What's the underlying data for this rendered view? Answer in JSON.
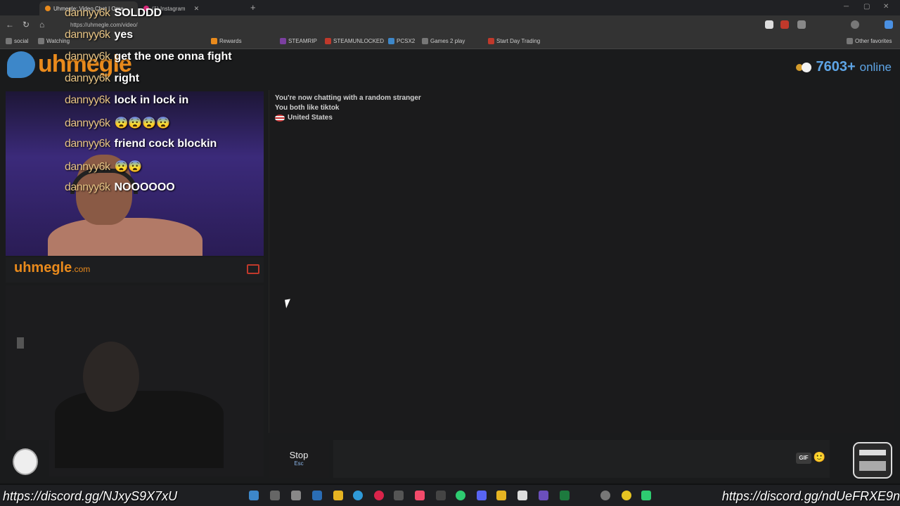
{
  "browser": {
    "tabs": [
      {
        "label": "Uhmegle: Video Chat | Ome...",
        "active": true
      },
      {
        "label": "(1) Instagram",
        "active": false
      }
    ],
    "url": "https://uhmegle.com/video/",
    "bookmarks": [
      "social",
      "Watching",
      "Rewards",
      "STEAMRIP",
      "STEAMUNLOCKED",
      "PCSX2",
      "Games 2 play",
      "Start Day Trading"
    ],
    "other_favorites": "Other favorites"
  },
  "site": {
    "logo_text": "uhmegle",
    "online_count": "7603+",
    "online_label": "online",
    "brand_main": "uhmegle",
    "brand_suffix": ".com"
  },
  "chat": {
    "messages": [
      "You're now chatting with a random stranger",
      "You both like tiktok"
    ],
    "country": "United States"
  },
  "controls": {
    "stop_label": "Stop",
    "stop_hint": "Esc",
    "gif_label": "GIF",
    "emoji": "🙂"
  },
  "overlay": {
    "lines": [
      {
        "user": "dannyy6k",
        "msg": "SOLDDD"
      },
      {
        "user": "dannyy6k",
        "msg": "yes"
      },
      {
        "user": "dannyy6k",
        "msg": "get the one onna fight"
      },
      {
        "user": "dannyy6k",
        "msg": "right"
      },
      {
        "user": "dannyy6k",
        "msg": "lock in lock in"
      },
      {
        "user": "dannyy6k",
        "msg": "😨😨😨😨"
      },
      {
        "user": "dannyy6k",
        "msg": "friend cock blockin"
      },
      {
        "user": "dannyy6k",
        "msg": "😨😨"
      },
      {
        "user": "dannyy6k",
        "msg": "NOOOOOO"
      }
    ]
  },
  "stream": {
    "discord_left": "https://discord.gg/NJxyS9X7xU",
    "discord_right": "https://discord.gg/ndUeFRXE9n"
  }
}
